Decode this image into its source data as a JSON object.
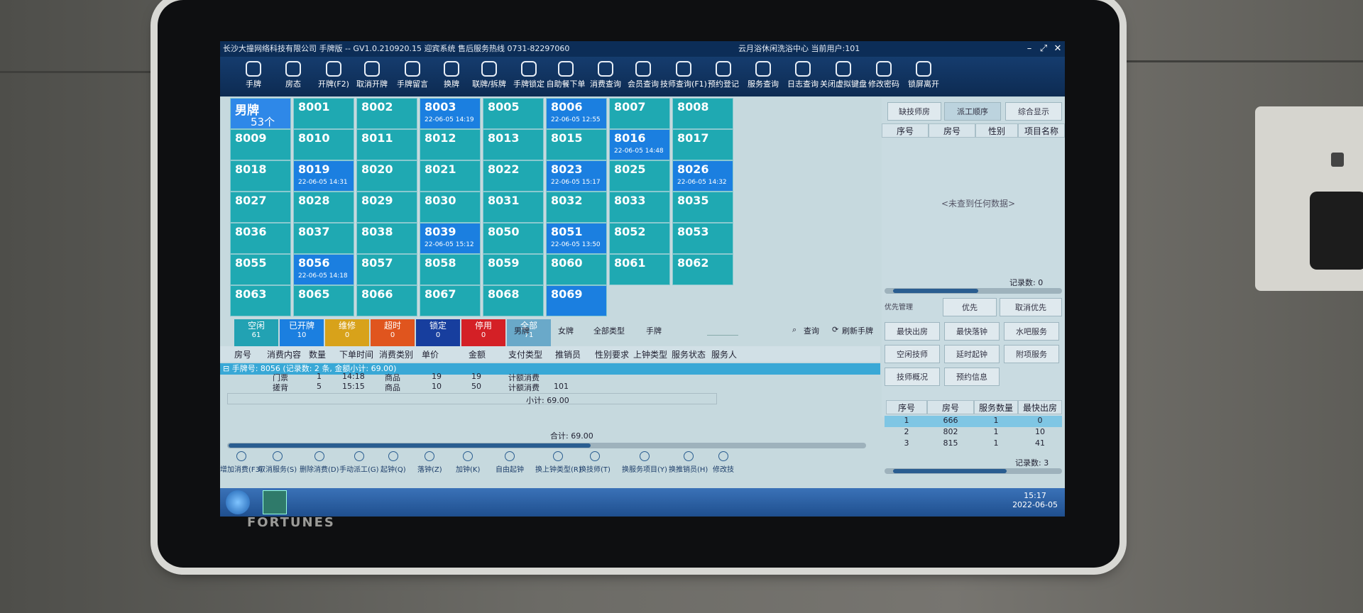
{
  "window": {
    "company": "长沙大撞网络科技有限公司 手牌版 -- GV1.0.210920.15 迎宾系统 售后服务热线 0731-82297060",
    "right_info": "云月浴休闲洗浴中心  当前用户:101",
    "controls": [
      "–",
      "⤢",
      "✕"
    ]
  },
  "toolbar": [
    {
      "label": "手牌",
      "icon": "disc-icon"
    },
    {
      "label": "房态",
      "icon": "home-icon"
    },
    {
      "label": "开牌(F2)",
      "icon": "open-icon"
    },
    {
      "label": "取消开牌",
      "icon": "cancel-open-icon"
    },
    {
      "label": "手牌留言",
      "icon": "message-icon"
    },
    {
      "label": "换牌",
      "icon": "swap-icon"
    },
    {
      "label": "联牌/拆牌",
      "icon": "link-icon"
    },
    {
      "label": "手牌锁定",
      "icon": "lock-icon"
    },
    {
      "label": "自助餐下单",
      "icon": "hand-icon"
    },
    {
      "label": "消费查询",
      "icon": "hand-icon"
    },
    {
      "label": "会员查询",
      "icon": "hand-icon"
    },
    {
      "label": "技师查询(F1)",
      "icon": "hand-icon"
    },
    {
      "label": "预约登记",
      "icon": "face-icon"
    },
    {
      "label": "服务查询",
      "icon": "star-icon"
    },
    {
      "label": "日志查询",
      "icon": "chat-icon"
    },
    {
      "label": "关闭虚拟键盘",
      "icon": "keyboard-icon"
    },
    {
      "label": "修改密码",
      "icon": "edit-icon"
    },
    {
      "label": "锁屏离开",
      "icon": "lock-icon"
    }
  ],
  "male_tile": {
    "label": "男牌",
    "count": "53个"
  },
  "cards": [
    {
      "no": "8001",
      "time": "",
      "open": false
    },
    {
      "no": "8002",
      "time": "",
      "open": false
    },
    {
      "no": "8003",
      "time": "22-06-05 14:19",
      "open": true
    },
    {
      "no": "8005",
      "time": "",
      "open": false
    },
    {
      "no": "8006",
      "time": "22-06-05 12:55",
      "open": true
    },
    {
      "no": "8007",
      "time": "",
      "open": false
    },
    {
      "no": "8008",
      "time": "",
      "open": false
    },
    {
      "no": "8009",
      "time": "",
      "open": false
    },
    {
      "no": "8010",
      "time": "",
      "open": false
    },
    {
      "no": "8011",
      "time": "",
      "open": false
    },
    {
      "no": "8012",
      "time": "",
      "open": false
    },
    {
      "no": "8013",
      "time": "",
      "open": false
    },
    {
      "no": "8015",
      "time": "",
      "open": false
    },
    {
      "no": "8016",
      "time": "22-06-05 14:48",
      "open": true
    },
    {
      "no": "8017",
      "time": "",
      "open": false
    },
    {
      "no": "8018",
      "time": "",
      "open": false
    },
    {
      "no": "8019",
      "time": "22-06-05 14:31",
      "open": true
    },
    {
      "no": "8020",
      "time": "",
      "open": false
    },
    {
      "no": "8021",
      "time": "",
      "open": false
    },
    {
      "no": "8022",
      "time": "",
      "open": false
    },
    {
      "no": "8023",
      "time": "22-06-05 15:17",
      "open": true
    },
    {
      "no": "8025",
      "time": "",
      "open": false
    },
    {
      "no": "8026",
      "time": "22-06-05 14:32",
      "open": true
    },
    {
      "no": "8027",
      "time": "",
      "open": false
    },
    {
      "no": "8028",
      "time": "",
      "open": false
    },
    {
      "no": "8029",
      "time": "",
      "open": false
    },
    {
      "no": "8030",
      "time": "",
      "open": false
    },
    {
      "no": "8031",
      "time": "",
      "open": false
    },
    {
      "no": "8032",
      "time": "",
      "open": false
    },
    {
      "no": "8033",
      "time": "",
      "open": false
    },
    {
      "no": "8035",
      "time": "",
      "open": false
    },
    {
      "no": "8036",
      "time": "",
      "open": false
    },
    {
      "no": "8037",
      "time": "",
      "open": false
    },
    {
      "no": "8038",
      "time": "",
      "open": false
    },
    {
      "no": "8039",
      "time": "22-06-05 15:12",
      "open": true
    },
    {
      "no": "8050",
      "time": "",
      "open": false
    },
    {
      "no": "8051",
      "time": "22-06-05 13:50",
      "open": true
    },
    {
      "no": "8052",
      "time": "",
      "open": false
    },
    {
      "no": "8053",
      "time": "",
      "open": false
    },
    {
      "no": "8055",
      "time": "",
      "open": false
    },
    {
      "no": "8056",
      "time": "22-06-05 14:18",
      "open": true
    },
    {
      "no": "8057",
      "time": "",
      "open": false
    },
    {
      "no": "8058",
      "time": "",
      "open": false
    },
    {
      "no": "8059",
      "time": "",
      "open": false
    },
    {
      "no": "8060",
      "time": "",
      "open": false
    },
    {
      "no": "8061",
      "time": "",
      "open": false
    },
    {
      "no": "8062",
      "time": "",
      "open": false
    },
    {
      "no": "8063",
      "time": "",
      "open": false
    },
    {
      "no": "8065",
      "time": "",
      "open": false
    },
    {
      "no": "8066",
      "time": "",
      "open": false
    },
    {
      "no": "8067",
      "time": "",
      "open": false
    },
    {
      "no": "8068",
      "time": "",
      "open": false
    },
    {
      "no": "8069",
      "time": "",
      "open": true
    }
  ],
  "status_tabs": [
    {
      "label": "空闲",
      "count": "61",
      "color": "#22a2b3"
    },
    {
      "label": "已开牌",
      "count": "10",
      "color": "#1b7fe0"
    },
    {
      "label": "维修",
      "count": "0",
      "color": "#d8a21a"
    },
    {
      "label": "超时",
      "count": "0",
      "color": "#e0551e"
    },
    {
      "label": "锁定",
      "count": "0",
      "color": "#173e9e"
    },
    {
      "label": "停用",
      "count": "0",
      "color": "#d42026"
    },
    {
      "label": "全部",
      "count": "71",
      "color": "#6aa9c9"
    }
  ],
  "filters": {
    "male": "男牌",
    "female": "女牌",
    "all_types": "全部类型",
    "card": "手牌",
    "query": "查询",
    "refresh": "刷新手牌"
  },
  "detail": {
    "columns": [
      "房号",
      "消费内容",
      "数量",
      "下单时间",
      "消费类别",
      "单价",
      "金额",
      "支付类型",
      "推销员",
      "性别要求",
      "上钟类型",
      "服务状态",
      "服务人"
    ],
    "group": "手牌号: 8056 (记录数: 2 条, 金额小计: 69.00)",
    "rows": [
      {
        "item": "门票",
        "qty": "1",
        "time": "14:18",
        "cat": "商品",
        "price": "19",
        "amount": "19",
        "pay": "计额消费",
        "sales": ""
      },
      {
        "item": "搓背",
        "qty": "5",
        "time": "15:15",
        "cat": "商品",
        "price": "10",
        "amount": "50",
        "pay": "计额消费",
        "sales": "101"
      }
    ],
    "subtotal": "小计: 69.00",
    "total": "合计: 69.00"
  },
  "bottom_actions": [
    "增加消费(F3)",
    "取消服务(S)",
    "删除消费(D)",
    "手动派工(G)",
    "起钟(Q)",
    "落钟(Z)",
    "加钟(K)",
    "自由起钟",
    "换上钟类型(R)",
    "换技师(T)",
    "换服务项目(Y)",
    "换推销员(H)",
    "修改技"
  ],
  "right_panel": {
    "tabs": [
      "缺技师房",
      "派工顺序",
      "综合显示"
    ],
    "columns": [
      "序号",
      "房号",
      "性别",
      "项目名称"
    ],
    "empty": "<未查到任何数据>",
    "record_count": "记录数: 0",
    "priority_label": "优先管理",
    "priority": "优先",
    "cancel_priority": "取消优先",
    "buttons": [
      "最快出房",
      "最快落钟",
      "水吧服务",
      "空闲技师",
      "延时起钟",
      "附项服务",
      "技师概况",
      "预约信息"
    ],
    "table2_columns": [
      "序号",
      "房号",
      "服务数量",
      "最快出房"
    ],
    "table2_rows": [
      [
        "1",
        "666",
        "1",
        "0"
      ],
      [
        "2",
        "802",
        "1",
        "10"
      ],
      [
        "3",
        "815",
        "1",
        "41"
      ]
    ],
    "record_count2": "记录数: 3"
  },
  "taskbar": {
    "time": "15:17",
    "date": "2022-06-05"
  },
  "device": {
    "brand": "FORTUNES"
  }
}
